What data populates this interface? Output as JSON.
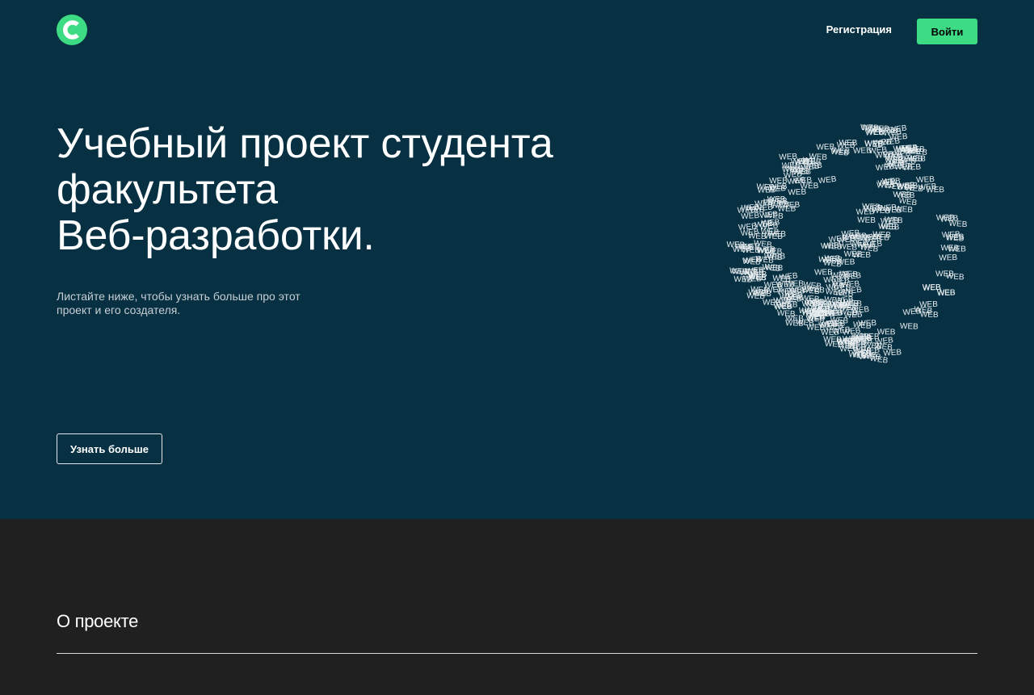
{
  "header": {
    "logo_letter": "C",
    "register_label": "Регистрация",
    "login_label": "Войти"
  },
  "hero": {
    "title_lines": [
      "Учебный проект студента",
      "факультета",
      "Веб-разработки."
    ],
    "description": "Листайте ниже, чтобы узнать больше про этот проект и его создателя.",
    "more_button_label": "Узнать больше",
    "figure_word": "WEB"
  },
  "about": {
    "title": "О проекте"
  },
  "colors": {
    "hero_bg": "#073042",
    "page_bg": "#202020",
    "accent": "#3ddc84"
  }
}
